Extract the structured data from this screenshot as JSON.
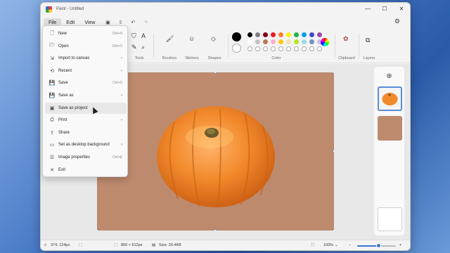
{
  "window": {
    "title": "Paint - Untitled"
  },
  "window_controls": {
    "minimize": "—",
    "maximize": "☐",
    "close": "✕"
  },
  "menubar": {
    "file": "File",
    "edit": "Edit",
    "view": "View"
  },
  "ribbon": {
    "groups": {
      "tools": "Tools",
      "brushes": "Brushes",
      "stickers": "Stickers",
      "shapes": "Shapes",
      "color": "Color",
      "clipboard": "Clipboard",
      "layers": "Layers"
    },
    "palette_row1": [
      "#000000",
      "#7f7f7f",
      "#880015",
      "#ed1c24",
      "#ff7f27",
      "#fff200",
      "#22b14c",
      "#00a2e8",
      "#3f48cc",
      "#a349a4"
    ],
    "palette_row2": [
      "#ffffff",
      "#c3c3c3",
      "#b97a57",
      "#ffaec9",
      "#ffc90e",
      "#efe4b0",
      "#b5e61d",
      "#99d9ea",
      "#7092be",
      "#c8bfe7"
    ],
    "primary_color": "#000000",
    "secondary_color": "#ffffff"
  },
  "file_menu": {
    "items": [
      {
        "icon": "new-icon",
        "glyph": "🗋",
        "label": "New",
        "shortcut": "Ctrl+N"
      },
      {
        "icon": "open-icon",
        "glyph": "🗁",
        "label": "Open",
        "shortcut": "Ctrl+O"
      },
      {
        "icon": "import-icon",
        "glyph": "⇲",
        "label": "Import to canvas",
        "arrow": "›"
      },
      {
        "icon": "recent-icon",
        "glyph": "⟲",
        "label": "Recent",
        "arrow": "›"
      },
      {
        "icon": "save-icon",
        "glyph": "💾",
        "label": "Save",
        "shortcut": "Ctrl+S"
      },
      {
        "icon": "save-as-icon",
        "glyph": "💾",
        "label": "Save as",
        "arrow": "›"
      },
      {
        "icon": "save-project-icon",
        "glyph": "▣",
        "label": "Save as project"
      },
      {
        "icon": "print-icon",
        "glyph": "⎙",
        "label": "Print",
        "arrow": "›"
      },
      {
        "icon": "share-icon",
        "glyph": "⇪",
        "label": "Share"
      },
      {
        "icon": "desktop-bg-icon",
        "glyph": "▭",
        "label": "Set as desktop background",
        "arrow": "›"
      },
      {
        "icon": "properties-icon",
        "glyph": "☰",
        "label": "Image properties",
        "shortcut": "Ctrl+E"
      },
      {
        "icon": "exit-icon",
        "glyph": "✕",
        "label": "Exit"
      }
    ]
  },
  "canvas": {
    "background": "#bd8a6e"
  },
  "status": {
    "cursor_pos": "374, 124px",
    "image_size": "800 × 512px",
    "file_size": "Size: 20.4KB",
    "zoom": "100%",
    "zoom_fraction": 0.55
  }
}
